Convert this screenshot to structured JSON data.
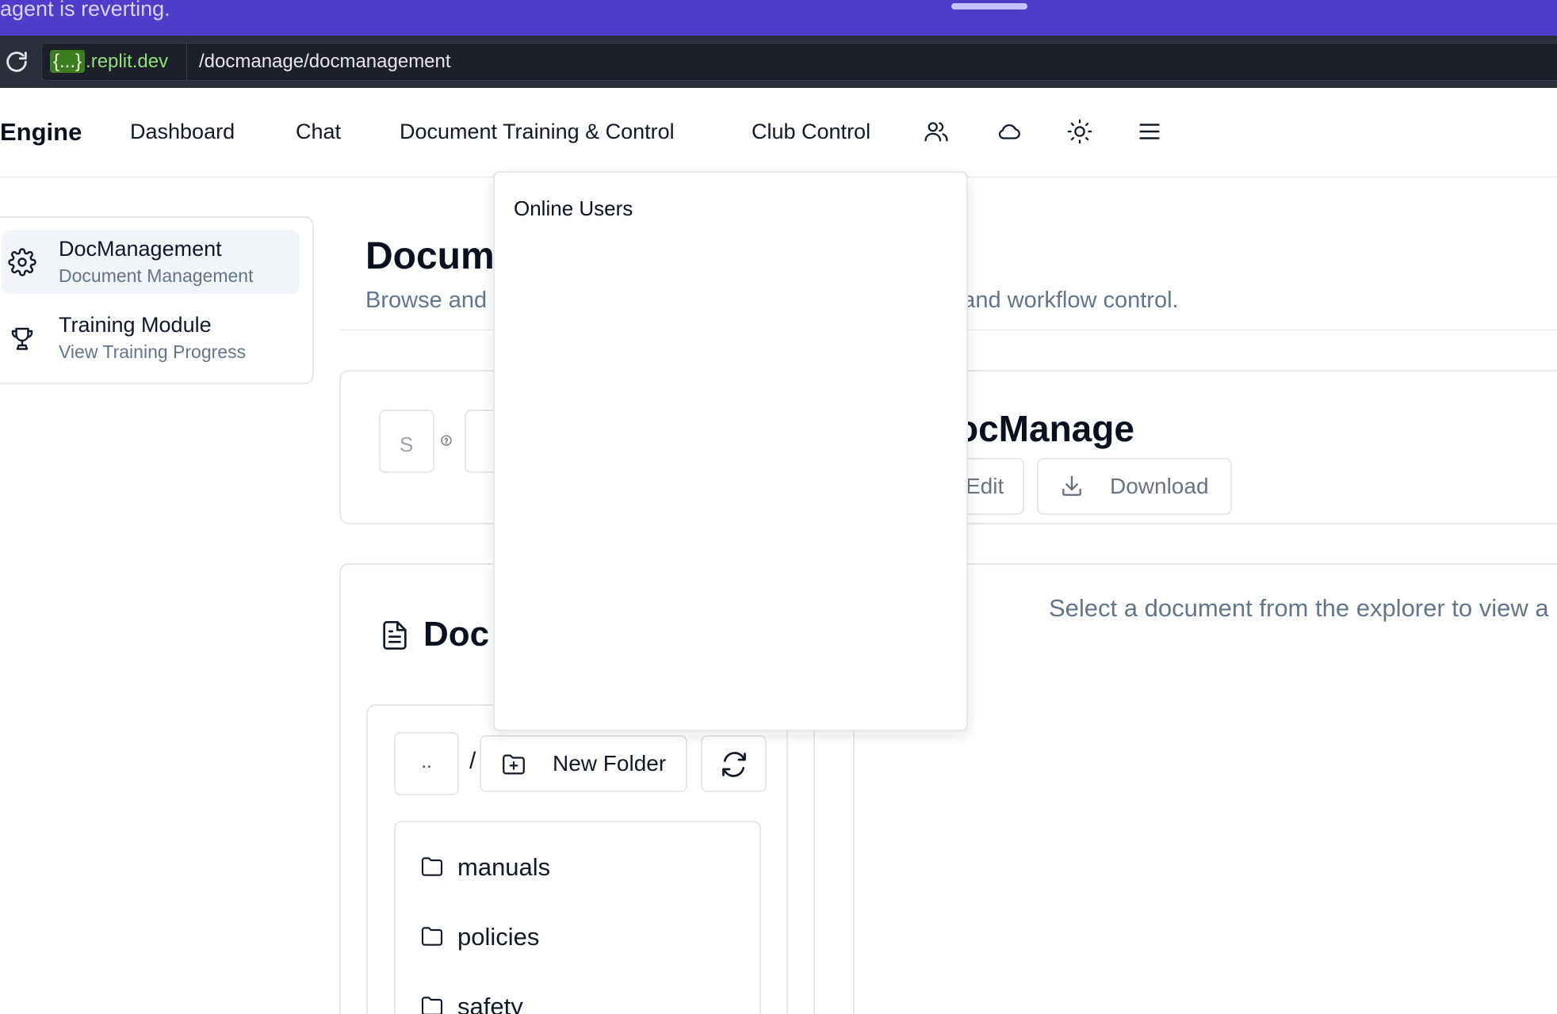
{
  "banner": {
    "status_text": "agent is reverting.",
    "accent": "#4f3cc9"
  },
  "browser": {
    "url_host_prefix": "{...}",
    "url_host_suffix": ".replit.dev",
    "url_path": "/docmanage/docmanagement",
    "reload_icon": "reload-icon"
  },
  "nav": {
    "brand": "Engine",
    "links": [
      "Dashboard",
      "Chat",
      "Document Training & Control",
      "Club Control"
    ],
    "icons": [
      "users-icon",
      "cloud-icon",
      "sun-icon",
      "menu-icon"
    ]
  },
  "sidebar": {
    "items": [
      {
        "title": "DocManagement",
        "subtitle": "Document Management",
        "icon": "gear-icon",
        "active": true
      },
      {
        "title": "Training Module",
        "subtitle": "View Training Progress",
        "icon": "trophy-icon",
        "active": false
      }
    ]
  },
  "page": {
    "title": "Docum",
    "subtitle_left": "Browse and",
    "subtitle_right": "g and workflow control."
  },
  "search": {
    "placeholder_visible": "S"
  },
  "explorer": {
    "title": "Doc",
    "up_label": "..",
    "breadcrumb_sep": "/",
    "new_folder_label": "New Folder",
    "folders": [
      "manuals",
      "policies",
      "safety"
    ]
  },
  "viewer": {
    "doc_title": "ocManage",
    "edit_label": "Edit",
    "download_label": "Download",
    "empty_message": "Select a document from the explorer to view a"
  },
  "popover": {
    "title": "Online Users"
  }
}
